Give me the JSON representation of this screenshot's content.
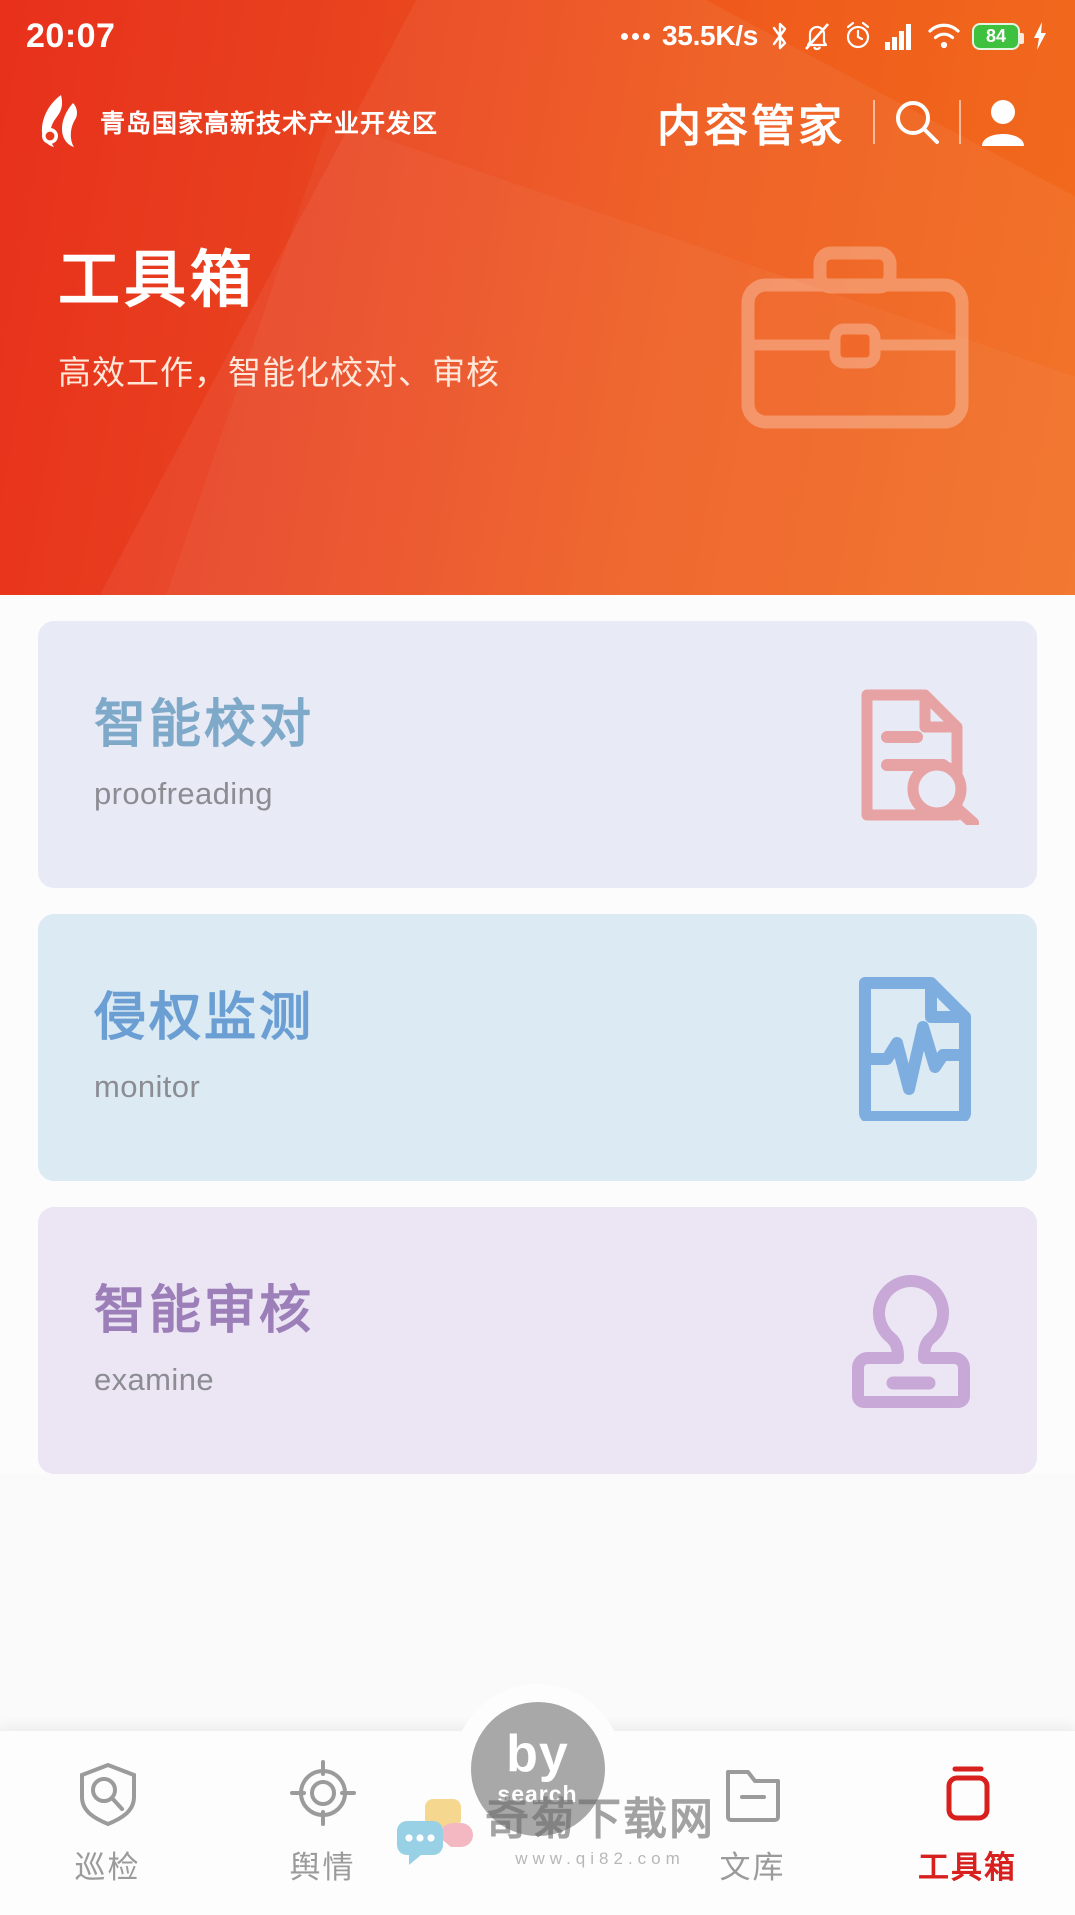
{
  "statusbar": {
    "time": "20:07",
    "network_speed": "35.5K/s",
    "battery_level": "84",
    "icons": [
      "dots-icon",
      "bluetooth-icon",
      "mute-bell-icon",
      "alarm-clock-icon",
      "cellular-signal-icon",
      "wifi-icon",
      "battery-icon",
      "charging-bolt-icon"
    ]
  },
  "header": {
    "brand_name": "青岛国家高新技术产业开发区",
    "app_title": "内容管家",
    "search_icon": "search-icon",
    "profile_icon": "user-avatar-icon"
  },
  "hero": {
    "title": "工具箱",
    "subtitle": "高效工作，智能化校对、审核",
    "icon": "briefcase-icon",
    "gradient_from": "#e8301b",
    "gradient_to": "#f26c1d"
  },
  "cards": [
    {
      "title": "智能校对",
      "subtitle": "proofreading",
      "icon": "document-search-icon",
      "bg": "#e8eaf6",
      "title_color": "#7fa9c9",
      "icon_color": "#e7a3a3"
    },
    {
      "title": "侵权监测",
      "subtitle": "monitor",
      "icon": "document-pulse-icon",
      "bg": "#dceaf3",
      "title_color": "#6b9fd4",
      "icon_color": "#7eaee0"
    },
    {
      "title": "智能审核",
      "subtitle": "examine",
      "icon": "rubber-stamp-icon",
      "bg": "#ebe5f4",
      "title_color": "#9c7eb8",
      "icon_color": "#c8a8d6"
    }
  ],
  "tabbar": {
    "active_color": "#d8201e",
    "inactive_color": "#9b9b9b",
    "items": [
      {
        "label": "巡检",
        "icon": "shield-search-icon",
        "active": false
      },
      {
        "label": "舆情",
        "icon": "target-crosshair-icon",
        "active": false
      },
      {
        "label": "文库",
        "icon": "folder-minus-icon",
        "active": false
      },
      {
        "label": "工具箱",
        "icon": "toolbox-icon",
        "active": true
      }
    ],
    "fab": {
      "line1": "by",
      "line2": "search"
    }
  },
  "watermark": {
    "title": "奇菊下载网",
    "url": "www.qi82.com"
  }
}
